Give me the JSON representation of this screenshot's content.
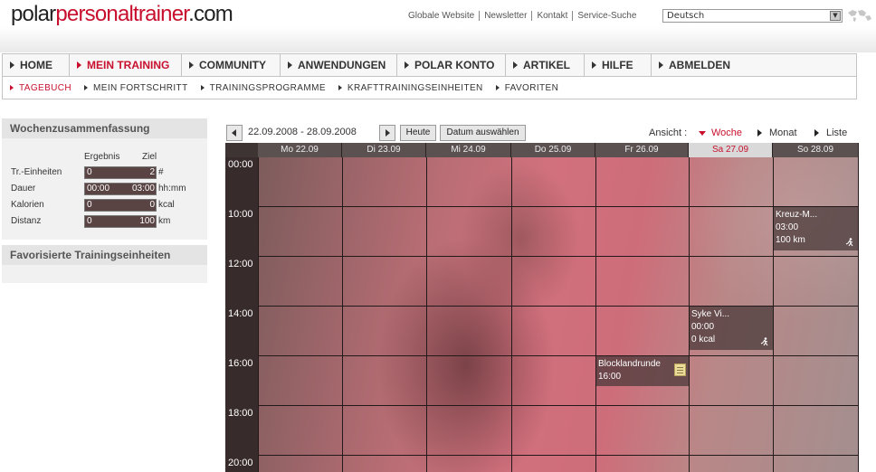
{
  "header": {
    "logo": {
      "part1": "polar",
      "part2": "personaltrainer",
      "part3": ".com"
    },
    "links": [
      "Globale Website",
      "Newsletter",
      "Kontakt",
      "Service-Suche"
    ],
    "language": "Deutsch"
  },
  "mainnav": [
    {
      "label": "HOME",
      "active": false
    },
    {
      "label": "MEIN TRAINING",
      "active": true
    },
    {
      "label": "COMMUNITY",
      "active": false
    },
    {
      "label": "ANWENDUNGEN",
      "active": false
    },
    {
      "label": "POLAR KONTO",
      "active": false
    },
    {
      "label": "ARTIKEL",
      "active": false
    },
    {
      "label": "HILFE",
      "active": false
    },
    {
      "label": "ABMELDEN",
      "active": false
    }
  ],
  "subnav": [
    {
      "label": "TAGEBUCH",
      "active": true
    },
    {
      "label": "MEIN FORTSCHRITT",
      "active": false
    },
    {
      "label": "TRAININGSPROGRAMME",
      "active": false
    },
    {
      "label": "KRAFTTRAININGSEINHEITEN",
      "active": false
    },
    {
      "label": "FAVORITEN",
      "active": false
    }
  ],
  "summary": {
    "title": "Wochenzusammenfassung",
    "col_result": "Ergebnis",
    "col_goal": "Ziel",
    "rows": [
      {
        "label": "Tr.-Einheiten",
        "result": "0",
        "goal": "2",
        "unit": "#"
      },
      {
        "label": "Dauer",
        "result": "00:00",
        "goal": "03:00",
        "unit": "hh:mm"
      },
      {
        "label": "Kalorien",
        "result": "0",
        "goal": "0",
        "unit": "kcal"
      },
      {
        "label": "Distanz",
        "result": "0",
        "goal": "100",
        "unit": "km"
      }
    ]
  },
  "favorites": {
    "title": "Favorisierte Trainingseinheiten"
  },
  "calendar": {
    "range": "22.09.2008 - 28.09.2008",
    "today_button": "Heute",
    "pick_date_button": "Datum auswählen",
    "view_label": "Ansicht :",
    "views": [
      {
        "label": "Woche",
        "active": true
      },
      {
        "label": "Monat",
        "active": false
      },
      {
        "label": "Liste",
        "active": false
      }
    ],
    "days": [
      {
        "label": "Mo 22.09",
        "today": false
      },
      {
        "label": "Di 23.09",
        "today": false
      },
      {
        "label": "Mi 24.09",
        "today": false
      },
      {
        "label": "Do 25.09",
        "today": false
      },
      {
        "label": "Fr 26.09",
        "today": false
      },
      {
        "label": "Sa 27.09",
        "today": true
      },
      {
        "label": "So 28.09",
        "today": false
      }
    ],
    "times": [
      "00:00",
      "10:00",
      "12:00",
      "14:00",
      "16:00",
      "18:00",
      "20:00"
    ],
    "events": [
      {
        "day": 6,
        "slot": 1,
        "lines": [
          "Kreuz-M...",
          "03:00",
          "100 km"
        ],
        "icon": "runner-icon"
      },
      {
        "day": 5,
        "slot": 3,
        "lines": [
          "Syke Vi...",
          "00:00",
          "0 kcal"
        ],
        "icon": "runner-icon"
      },
      {
        "day": 4,
        "slot": 4,
        "lines": [
          "Blocklandrunde",
          "16:00"
        ],
        "icon": "note-icon"
      }
    ]
  }
}
